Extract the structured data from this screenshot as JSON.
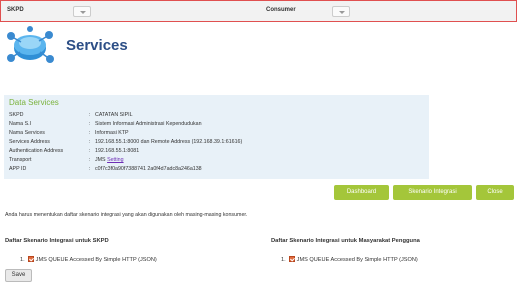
{
  "filters": {
    "skpd_label": "SKPD",
    "consumer_label": "Consumer"
  },
  "header": {
    "title": "Services"
  },
  "data_services": {
    "title": "Data Services",
    "rows": [
      {
        "label": "SKPD",
        "value": "CATATAN SIPIL"
      },
      {
        "label": "Nama S.I",
        "value": "Sistem Informasi Administrasi Kependudukan"
      },
      {
        "label": "Nama Services",
        "value": "Informasi KTP"
      },
      {
        "label": "Services Address",
        "value": "192.168.55.1:8000 dan Remote Address (192.168.39.1:61616)"
      },
      {
        "label": "Authentication Address",
        "value": "192.168.55.1:8081"
      },
      {
        "label": "Transport",
        "value": "JMS",
        "link": "Setting"
      },
      {
        "label": "APP ID",
        "value": "c0f7c3f0a90f7388741 2a0f4d7adc8a246a138"
      }
    ],
    "separator": ":"
  },
  "actions": {
    "dashboard": "Dashboard",
    "skenario": "Skenario Integrasi",
    "close": "Close"
  },
  "info_text": "Anda harus menentukan daftar skenario integrasi yang akan digunakan oleh masing-masing konsumer.",
  "left_section": {
    "heading": "Daftar Skenario Integrasi untuk SKPD",
    "item_num": "1.",
    "item_label": "JMS QUEUE Accessed By Simple HTTP (JSON)"
  },
  "right_section": {
    "heading": "Daftar Skenario Integrasi untuk Masyarakat Pengguna",
    "item_num": "1.",
    "item_label": "JMS QUEUE Accessed By Simple HTTP (JSON)"
  },
  "save_label": "Save"
}
